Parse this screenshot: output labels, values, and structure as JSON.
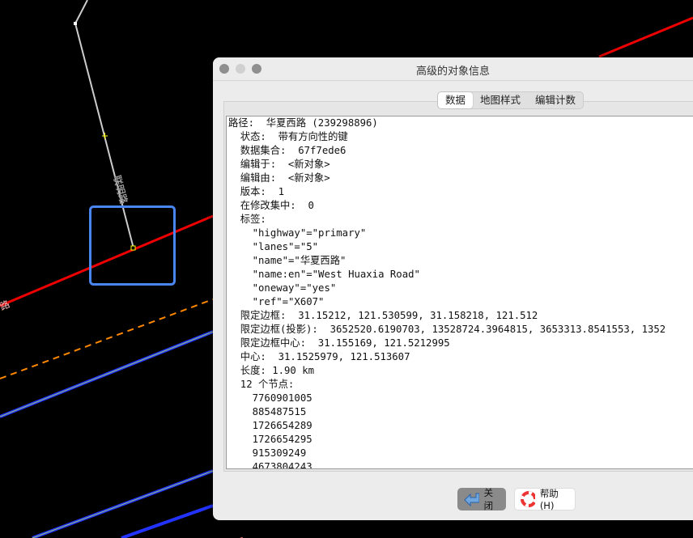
{
  "map": {
    "road_label_1": "联明路",
    "road_label_2": "路"
  },
  "dialog": {
    "title": "高级的对象信息",
    "tabs": [
      "数据",
      "地图样式",
      "编辑计数"
    ],
    "active_tab": "数据",
    "lines": [
      "路径:  华夏西路 (239298896)",
      "  状态:  带有方向性的键",
      "  数据集合:  67f7ede6",
      "  编辑于:  <新对象>",
      "  编辑由:  <新对象>",
      "  版本:  1",
      "  在修改集中:  0",
      "  标签:",
      "    \"highway\"=\"primary\"",
      "    \"lanes\"=\"5\"",
      "    \"name\"=\"华夏西路\"",
      "    \"name:en\"=\"West Huaxia Road\"",
      "    \"oneway\"=\"yes\"",
      "    \"ref\"=\"X607\"",
      "  限定边框:  31.15212, 121.530599, 31.158218, 121.512",
      "  限定边框(投影):  3652520.6190703, 13528724.3964815, 3653313.8541553, 1352",
      "  限定边框中心:  31.155169, 121.5212995",
      "  中心:  31.1525979, 121.513607",
      "  长度: 1.90 km",
      "  12 个节点:",
      "    7760901005",
      "    885487515",
      "    1726654289",
      "    1726654295",
      "    915309249",
      "    4673804243"
    ],
    "close_label": "关闭",
    "help_label": "帮助(H)"
  }
}
